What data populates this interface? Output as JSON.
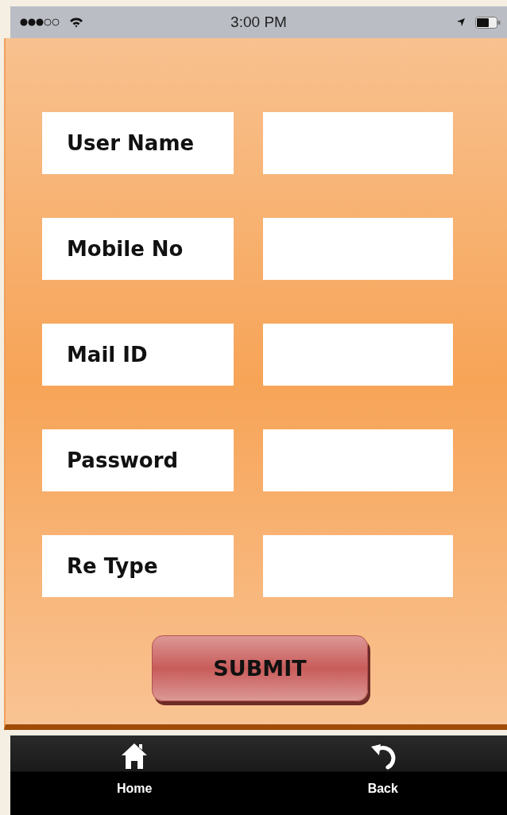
{
  "status_bar": {
    "time": "3:00 PM"
  },
  "form": {
    "fields": [
      {
        "label": "User Name"
      },
      {
        "label": "Mobile No"
      },
      {
        "label": "Mail ID"
      },
      {
        "label": "Password"
      },
      {
        "label": "Re Type"
      }
    ],
    "submit": "SUBMIT"
  },
  "tab_bar": [
    {
      "label": "Home",
      "kind": "home"
    },
    {
      "label": "Back",
      "kind": "back"
    }
  ]
}
